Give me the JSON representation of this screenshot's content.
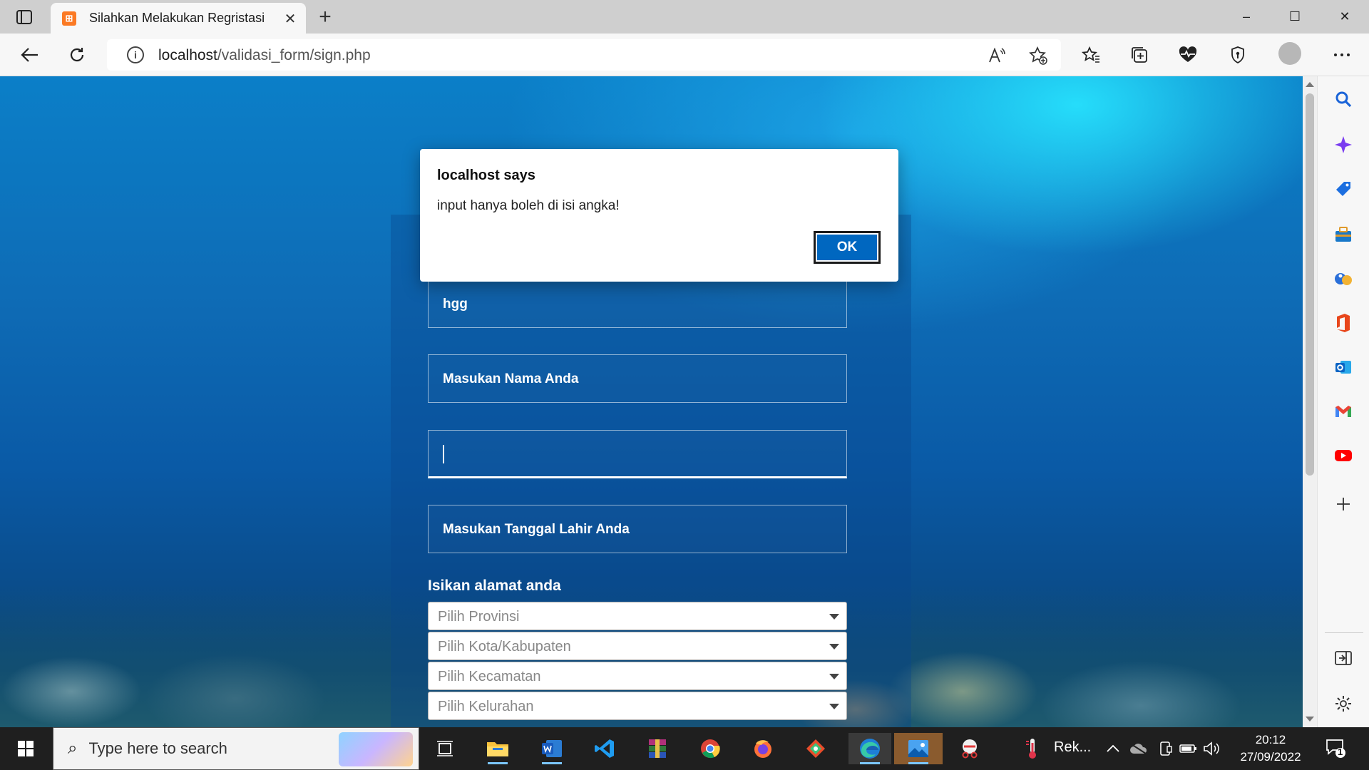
{
  "browser": {
    "tab": {
      "title": "Silahkan Melakukan Regristasi",
      "favicon_letters": "⊞"
    },
    "url": {
      "host": "localhost",
      "path": "/validasi_form/sign.php"
    },
    "window_controls": {
      "minimize": "–",
      "maximize": "☐",
      "close": "✕"
    },
    "new_tab": "+",
    "close_tab": "✕"
  },
  "dialog": {
    "title": "localhost says",
    "message": "input hanya boleh di isi angka!",
    "ok_label": "OK"
  },
  "form": {
    "field1_value": "hgg",
    "field2_placeholder": "Masukan Nama Anda",
    "field3_value": "",
    "field4_placeholder": "Masukan Tanggal Lahir Anda",
    "address_label": "Isikan alamat anda",
    "selects": [
      {
        "placeholder": "Pilih Provinsi"
      },
      {
        "placeholder": "Pilih Kota/Kabupaten"
      },
      {
        "placeholder": "Pilih Kecamatan"
      },
      {
        "placeholder": "Pilih Kelurahan"
      }
    ]
  },
  "taskbar": {
    "search_placeholder": "Type here to search",
    "tray_app_label": "Rek...",
    "time": "20:12",
    "date": "27/09/2022",
    "notification_count": "1"
  },
  "colors": {
    "accent": "#0067c0",
    "page_water": "#0b6fb8",
    "taskbar": "#1f1f1f"
  }
}
